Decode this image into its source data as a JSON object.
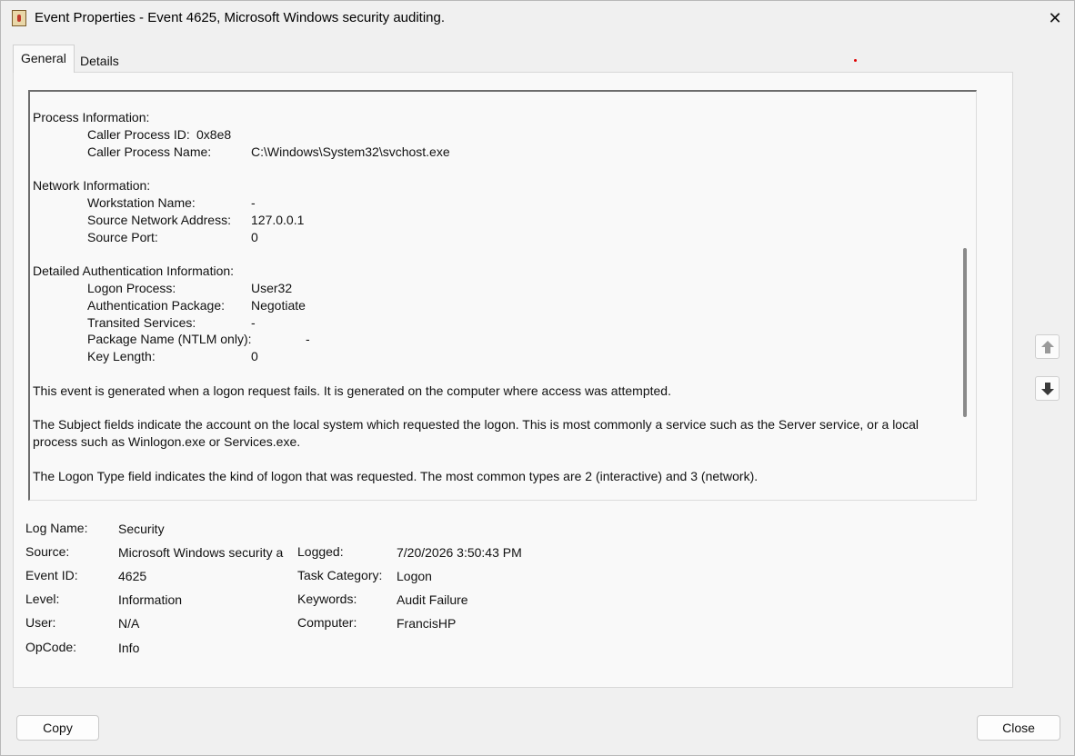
{
  "window": {
    "title": "Event Properties - Event 4625, Microsoft Windows security auditing."
  },
  "tabs": [
    {
      "label": "General",
      "active": true
    },
    {
      "label": "Details",
      "active": false
    }
  ],
  "description": {
    "process_header": "Process Information:",
    "caller_pid_label": "Caller Process ID:",
    "caller_pid_value": "0x8e8",
    "caller_name_label": "Caller Process Name:",
    "caller_name_value": "C:\\Windows\\System32\\svchost.exe",
    "network_header": "Network Information:",
    "workstation_label": "Workstation Name:",
    "workstation_value": "-",
    "source_addr_label": "Source Network Address:",
    "source_addr_value": "127.0.0.1",
    "source_port_label": "Source Port:",
    "source_port_value": "0",
    "auth_header": "Detailed Authentication Information:",
    "logon_process_label": "Logon Process:",
    "logon_process_value": "User32",
    "auth_package_label": "Authentication Package:",
    "auth_package_value": "Negotiate",
    "transited_label": "Transited Services:",
    "transited_value": "-",
    "package_name_label": "Package Name (NTLM only):",
    "package_name_value": "-",
    "key_length_label": "Key Length:",
    "key_length_value": "0",
    "para1": "This event is generated when a logon request fails. It is generated on the computer where access was attempted.",
    "para2": "The Subject fields indicate the account on the local system which requested the logon. This is most commonly a service such as the Server service, or a local process such as Winlogon.exe or Services.exe.",
    "para3": "The Logon Type field indicates the kind of logon that was requested. The most common types are 2 (interactive) and 3 (network)."
  },
  "meta": {
    "log_name_label": "Log Name:",
    "log_name_value": "Security",
    "source_label": "Source:",
    "source_value": "Microsoft Windows security a",
    "logged_label": "Logged:",
    "logged_value": "7/20/2026 3:50:43 PM",
    "event_id_label": "Event ID:",
    "event_id_value": "4625",
    "task_category_label": "Task Category:",
    "task_category_value": "Logon",
    "level_label": "Level:",
    "level_value": "Information",
    "keywords_label": "Keywords:",
    "keywords_value": "Audit Failure",
    "user_label": "User:",
    "user_value": "N/A",
    "computer_label": "Computer:",
    "computer_value": "FrancisHP",
    "opcode_label": "OpCode:",
    "opcode_value": "Info"
  },
  "buttons": {
    "copy": "Copy",
    "close": "Close"
  },
  "icons": {
    "app": "event-viewer-icon",
    "close": "close-icon",
    "up": "arrow-up-icon",
    "down": "arrow-down-icon"
  }
}
